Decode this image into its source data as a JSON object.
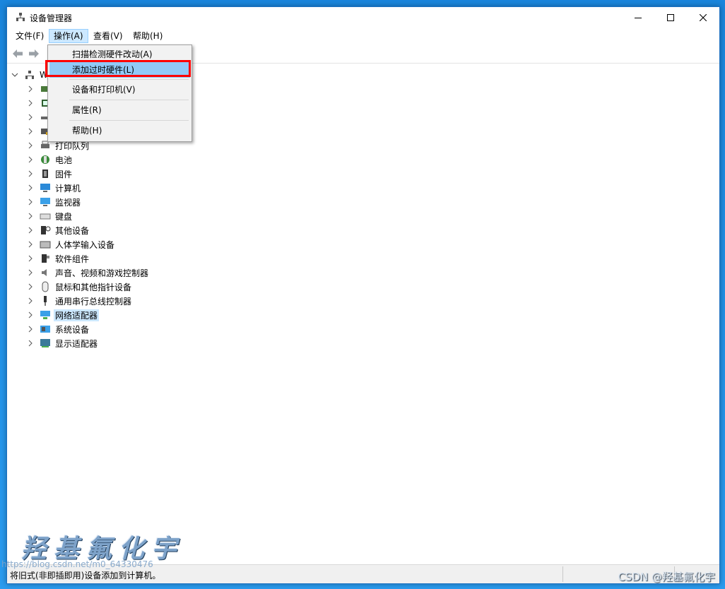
{
  "window": {
    "title": "设备管理器",
    "min_icon": "minimize-icon",
    "max_icon": "maximize-icon",
    "close_icon": "close-icon"
  },
  "menubar": {
    "items": [
      "文件(F)",
      "操作(A)",
      "查看(V)",
      "帮助(H)"
    ],
    "active_index": 1
  },
  "dropdown": {
    "items": [
      "扫描检测硬件改动(A)",
      "添加过时硬件(L)",
      "设备和打印机(V)",
      "属性(R)",
      "帮助(H)"
    ],
    "highlighted_index": 1
  },
  "tree": {
    "root_label": "W",
    "nodes": [
      "",
      "",
      "",
      "",
      "打印队列",
      "电池",
      "固件",
      "计算机",
      "监视器",
      "键盘",
      "其他设备",
      "人体学输入设备",
      "软件组件",
      "声音、视频和游戏控制器",
      "鼠标和其他指针设备",
      "通用串行总线控制器",
      "网络适配器",
      "系统设备",
      "显示适配器"
    ],
    "selected_label": "网络适配器"
  },
  "statusbar": {
    "text": "将旧式(非即插即用)设备添加到计算机。"
  },
  "watermarks": {
    "stylized": "羟基氟化宇",
    "url": "https://blog.csdn.net/m0_64330476",
    "csdn": "CSDN @羟基氟化宇"
  },
  "colors": {
    "accent": "#cce8ff",
    "highlight": "#91c9f7",
    "annotation": "#ff0000",
    "desktop": "#1f8fe6"
  }
}
